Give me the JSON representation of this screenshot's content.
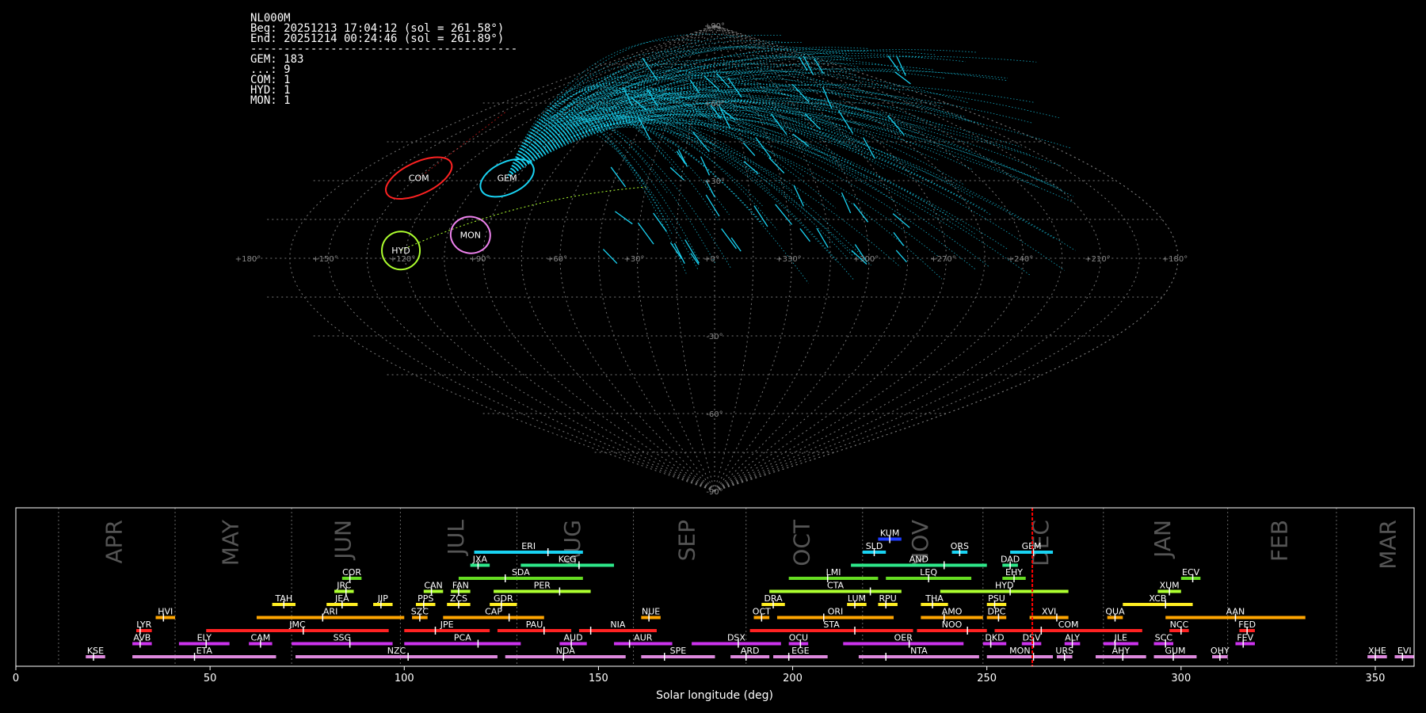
{
  "info": {
    "station": "NL000M",
    "beg": "Beg: 20251213 17:04:12 (sol = 261.58°)",
    "end": "End: 20251214 00:24:46 (sol = 261.89°)",
    "separator": "----------------------------------------",
    "counts": [
      "GEM: 183",
      "...: 9",
      "COM: 1",
      "HYD: 1",
      "MON: 1"
    ]
  },
  "chart_data": [
    {
      "type": "scatter",
      "projection": "sinusoidal sky map",
      "lon_tick_labels": [
        "+180°",
        "+150°",
        "+120°",
        "+90°",
        "+60°",
        "+30°",
        "+0°",
        "+330°",
        "+300°",
        "+270°",
        "+240°",
        "+210°",
        "+180°"
      ],
      "lat_tick_labels": [
        "+90°",
        "+60°",
        "+30°",
        "-30°",
        "-60°",
        "-90°"
      ],
      "radiants": [
        {
          "name": "COM",
          "lon": 134,
          "lat": 31,
          "color": "#ff2222"
        },
        {
          "name": "GEM",
          "lon": 94,
          "lat": 31,
          "color": "#19d3f3"
        },
        {
          "name": "MON",
          "lon": 96,
          "lat": 9,
          "color": "#ee82ee"
        },
        {
          "name": "HYD",
          "lon": 122,
          "lat": 3,
          "color": "#adff2f"
        }
      ],
      "meteor_counts": {
        "GEM": 183,
        "...": 9,
        "COM": 1,
        "HYD": 1,
        "MON": 1
      }
    },
    {
      "type": "timeline",
      "xlabel": "Solar longitude (deg)",
      "xlim": [
        0,
        360
      ],
      "xticks": [
        0,
        50,
        100,
        150,
        200,
        250,
        300,
        350
      ],
      "current_sol": 261.7,
      "months": [
        {
          "label": "APR",
          "start": 11
        },
        {
          "label": "MAY",
          "start": 41
        },
        {
          "label": "JUN",
          "start": 71
        },
        {
          "label": "JUL",
          "start": 99
        },
        {
          "label": "AUG",
          "start": 129
        },
        {
          "label": "SEP",
          "start": 159
        },
        {
          "label": "OCT",
          "start": 188
        },
        {
          "label": "NOV",
          "start": 218
        },
        {
          "label": "DEC",
          "start": 249
        },
        {
          "label": "JAN",
          "start": 280
        },
        {
          "label": "FEB",
          "start": 312
        },
        {
          "label": "MAR",
          "start": 340
        }
      ],
      "showers": [
        {
          "code": "KUM",
          "start": 222,
          "end": 228,
          "peak": 225,
          "row": 9,
          "color": "#1e3cff"
        },
        {
          "code": "ERI",
          "start": 118,
          "end": 146,
          "peak": 137,
          "row": 8,
          "color": "#19d3f3"
        },
        {
          "code": "SLD",
          "start": 218,
          "end": 224,
          "peak": 221,
          "row": 8,
          "color": "#19d3f3"
        },
        {
          "code": "ORS",
          "start": 241,
          "end": 245,
          "peak": 243,
          "row": 8,
          "color": "#19d3f3"
        },
        {
          "code": "GEM",
          "start": 256,
          "end": 267,
          "peak": 262,
          "row": 8,
          "color": "#19d3f3"
        },
        {
          "code": "JXA",
          "start": 117,
          "end": 122,
          "peak": 119,
          "row": 7,
          "color": "#2ee88a"
        },
        {
          "code": "KCG",
          "start": 130,
          "end": 154,
          "peak": 145,
          "row": 7,
          "color": "#2ee88a"
        },
        {
          "code": "AND",
          "start": 215,
          "end": 250,
          "peak": 239,
          "row": 7,
          "color": "#2ee88a"
        },
        {
          "code": "DAD",
          "start": 254,
          "end": 258,
          "peak": 256,
          "row": 7,
          "color": "#2ee88a"
        },
        {
          "code": "COR",
          "start": 84,
          "end": 89,
          "peak": 86,
          "row": 6,
          "color": "#66dd22"
        },
        {
          "code": "SDA",
          "start": 114,
          "end": 146,
          "peak": 126,
          "row": 6,
          "color": "#66dd22"
        },
        {
          "code": "LMI",
          "start": 199,
          "end": 222,
          "peak": 209,
          "row": 6,
          "color": "#66dd22"
        },
        {
          "code": "LEQ",
          "start": 224,
          "end": 246,
          "peak": 235,
          "row": 6,
          "color": "#66dd22"
        },
        {
          "code": "EHY",
          "start": 254,
          "end": 260,
          "peak": 257,
          "row": 6,
          "color": "#66dd22"
        },
        {
          "code": "ECV",
          "start": 300,
          "end": 305,
          "peak": 303,
          "row": 6,
          "color": "#66dd22"
        },
        {
          "code": "JRC",
          "start": 82,
          "end": 87,
          "peak": 85,
          "row": 5,
          "color": "#adff2f"
        },
        {
          "code": "CAN",
          "start": 105,
          "end": 110,
          "peak": 107,
          "row": 5,
          "color": "#adff2f"
        },
        {
          "code": "FAN",
          "start": 112,
          "end": 117,
          "peak": 114,
          "row": 5,
          "color": "#adff2f"
        },
        {
          "code": "PER",
          "start": 123,
          "end": 148,
          "peak": 140,
          "row": 5,
          "color": "#adff2f"
        },
        {
          "code": "CTA",
          "start": 194,
          "end": 228,
          "peak": 220,
          "row": 5,
          "color": "#adff2f"
        },
        {
          "code": "HYD",
          "start": 238,
          "end": 271,
          "peak": 256,
          "row": 5,
          "color": "#adff2f"
        },
        {
          "code": "XUM",
          "start": 294,
          "end": 300,
          "peak": 297,
          "row": 5,
          "color": "#adff2f"
        },
        {
          "code": "TAH",
          "start": 66,
          "end": 72,
          "peak": 69,
          "row": 4,
          "color": "#ffee22"
        },
        {
          "code": "JEA",
          "start": 80,
          "end": 88,
          "peak": 84,
          "row": 4,
          "color": "#ffee22"
        },
        {
          "code": "JIP",
          "start": 92,
          "end": 97,
          "peak": 94,
          "row": 4,
          "color": "#ffee22"
        },
        {
          "code": "PPS",
          "start": 103,
          "end": 108,
          "peak": 105,
          "row": 4,
          "color": "#ffee22"
        },
        {
          "code": "ZCS",
          "start": 111,
          "end": 117,
          "peak": 114,
          "row": 4,
          "color": "#ffee22"
        },
        {
          "code": "GDR",
          "start": 122,
          "end": 129,
          "peak": 125,
          "row": 4,
          "color": "#ffee22"
        },
        {
          "code": "DRA",
          "start": 192,
          "end": 198,
          "peak": 195,
          "row": 4,
          "color": "#ffee22"
        },
        {
          "code": "LUM",
          "start": 214,
          "end": 219,
          "peak": 216,
          "row": 4,
          "color": "#ffee22"
        },
        {
          "code": "RPU",
          "start": 222,
          "end": 227,
          "peak": 224,
          "row": 4,
          "color": "#ffee22"
        },
        {
          "code": "THA",
          "start": 233,
          "end": 240,
          "peak": 236,
          "row": 4,
          "color": "#ffee22"
        },
        {
          "code": "PSU",
          "start": 250,
          "end": 255,
          "peak": 252,
          "row": 4,
          "color": "#ffee22"
        },
        {
          "code": "XCB",
          "start": 285,
          "end": 303,
          "peak": 296,
          "row": 4,
          "color": "#ffee22"
        },
        {
          "code": "HVI",
          "start": 36,
          "end": 41,
          "peak": 38,
          "row": 3,
          "color": "#ffa500"
        },
        {
          "code": "ARI",
          "start": 62,
          "end": 100,
          "peak": 79,
          "row": 3,
          "color": "#ffa500"
        },
        {
          "code": "SZC",
          "start": 102,
          "end": 106,
          "peak": 104,
          "row": 3,
          "color": "#ffa500"
        },
        {
          "code": "CAP",
          "start": 110,
          "end": 136,
          "peak": 127,
          "row": 3,
          "color": "#ffa500"
        },
        {
          "code": "NUE",
          "start": 161,
          "end": 166,
          "peak": 163,
          "row": 3,
          "color": "#ffa500"
        },
        {
          "code": "OCT",
          "start": 190,
          "end": 194,
          "peak": 192,
          "row": 3,
          "color": "#ffa500"
        },
        {
          "code": "ORI",
          "start": 196,
          "end": 226,
          "peak": 208,
          "row": 3,
          "color": "#ffa500"
        },
        {
          "code": "AMO",
          "start": 233,
          "end": 249,
          "peak": 239,
          "row": 3,
          "color": "#ffa500"
        },
        {
          "code": "DPC",
          "start": 250,
          "end": 255,
          "peak": 253,
          "row": 3,
          "color": "#ffa500"
        },
        {
          "code": "XVI",
          "start": 261,
          "end": 271,
          "peak": 268,
          "row": 3,
          "color": "#ffa500"
        },
        {
          "code": "QUA",
          "start": 281,
          "end": 285,
          "peak": 283,
          "row": 3,
          "color": "#ffa500"
        },
        {
          "code": "AAN",
          "start": 296,
          "end": 332,
          "peak": 314,
          "row": 3,
          "color": "#ffa500"
        },
        {
          "code": "LYR",
          "start": 31,
          "end": 35,
          "peak": 32,
          "row": 2,
          "color": "#ff2222"
        },
        {
          "code": "JMC",
          "start": 49,
          "end": 96,
          "peak": 74,
          "row": 2,
          "color": "#ff2222"
        },
        {
          "code": "JPE",
          "start": 100,
          "end": 122,
          "peak": 108,
          "row": 2,
          "color": "#ff2222"
        },
        {
          "code": "PAU",
          "start": 124,
          "end": 143,
          "peak": 136,
          "row": 2,
          "color": "#ff2222"
        },
        {
          "code": "NIA",
          "start": 145,
          "end": 165,
          "peak": 148,
          "row": 2,
          "color": "#ff2222"
        },
        {
          "code": "STA",
          "start": 189,
          "end": 231,
          "peak": 216,
          "row": 2,
          "color": "#ff2222"
        },
        {
          "code": "NOO",
          "start": 232,
          "end": 250,
          "peak": 245,
          "row": 2,
          "color": "#ff2222"
        },
        {
          "code": "COM",
          "start": 252,
          "end": 290,
          "peak": 264,
          "row": 2,
          "color": "#ff2222"
        },
        {
          "code": "NCC",
          "start": 297,
          "end": 302,
          "peak": 300,
          "row": 2,
          "color": "#ff2222"
        },
        {
          "code": "FED",
          "start": 315,
          "end": 319,
          "peak": 317,
          "row": 2,
          "color": "#ff2222"
        },
        {
          "code": "AVB",
          "start": 30,
          "end": 35,
          "peak": 32,
          "row": 1,
          "color": "#cc33ee"
        },
        {
          "code": "ELY",
          "start": 42,
          "end": 55,
          "peak": 49,
          "row": 1,
          "color": "#cc33ee"
        },
        {
          "code": "CAM",
          "start": 60,
          "end": 66,
          "peak": 63,
          "row": 1,
          "color": "#cc33ee"
        },
        {
          "code": "SSG",
          "start": 71,
          "end": 97,
          "peak": 86,
          "row": 1,
          "color": "#cc33ee"
        },
        {
          "code": "PCA",
          "start": 100,
          "end": 130,
          "peak": 119,
          "row": 1,
          "color": "#cc33ee"
        },
        {
          "code": "AUD",
          "start": 140,
          "end": 147,
          "peak": 143,
          "row": 1,
          "color": "#cc33ee"
        },
        {
          "code": "AUR",
          "start": 154,
          "end": 169,
          "peak": 158,
          "row": 1,
          "color": "#cc33ee"
        },
        {
          "code": "DSX",
          "start": 174,
          "end": 197,
          "peak": 186,
          "row": 1,
          "color": "#cc33ee"
        },
        {
          "code": "OCU",
          "start": 199,
          "end": 204,
          "peak": 202,
          "row": 1,
          "color": "#cc33ee"
        },
        {
          "code": "OER",
          "start": 213,
          "end": 244,
          "peak": 230,
          "row": 1,
          "color": "#cc33ee"
        },
        {
          "code": "DKD",
          "start": 249,
          "end": 255,
          "peak": 251,
          "row": 1,
          "color": "#cc33ee"
        },
        {
          "code": "DSV",
          "start": 259,
          "end": 264,
          "peak": 262,
          "row": 1,
          "color": "#cc33ee"
        },
        {
          "code": "ALY",
          "start": 270,
          "end": 274,
          "peak": 272,
          "row": 1,
          "color": "#cc33ee"
        },
        {
          "code": "JLE",
          "start": 280,
          "end": 289,
          "peak": 283,
          "row": 1,
          "color": "#cc33ee"
        },
        {
          "code": "SCC",
          "start": 293,
          "end": 298,
          "peak": 296,
          "row": 1,
          "color": "#cc33ee"
        },
        {
          "code": "FEV",
          "start": 314,
          "end": 319,
          "peak": 316,
          "row": 1,
          "color": "#cc33ee"
        },
        {
          "code": "KSE",
          "start": 18,
          "end": 23,
          "peak": 20,
          "row": 0,
          "color": "#dd88dd"
        },
        {
          "code": "ETA",
          "start": 30,
          "end": 67,
          "peak": 46,
          "row": 0,
          "color": "#dd88dd"
        },
        {
          "code": "NZC",
          "start": 72,
          "end": 124,
          "peak": 101,
          "row": 0,
          "color": "#dd88dd"
        },
        {
          "code": "NDA",
          "start": 126,
          "end": 157,
          "peak": 141,
          "row": 0,
          "color": "#dd88dd"
        },
        {
          "code": "SPE",
          "start": 161,
          "end": 180,
          "peak": 167,
          "row": 0,
          "color": "#dd88dd"
        },
        {
          "code": "ARD",
          "start": 184,
          "end": 194,
          "peak": 188,
          "row": 0,
          "color": "#dd88dd"
        },
        {
          "code": "EGE",
          "start": 195,
          "end": 209,
          "peak": 199,
          "row": 0,
          "color": "#dd88dd"
        },
        {
          "code": "NTA",
          "start": 217,
          "end": 248,
          "peak": 224,
          "row": 0,
          "color": "#dd88dd"
        },
        {
          "code": "MON",
          "start": 250,
          "end": 267,
          "peak": 262,
          "row": 0,
          "color": "#dd88dd"
        },
        {
          "code": "URS",
          "start": 268,
          "end": 272,
          "peak": 270,
          "row": 0,
          "color": "#dd88dd"
        },
        {
          "code": "AHY",
          "start": 278,
          "end": 291,
          "peak": 285,
          "row": 0,
          "color": "#dd88dd"
        },
        {
          "code": "GUM",
          "start": 293,
          "end": 304,
          "peak": 298,
          "row": 0,
          "color": "#dd88dd"
        },
        {
          "code": "OHY",
          "start": 308,
          "end": 312,
          "peak": 310,
          "row": 0,
          "color": "#dd88dd"
        },
        {
          "code": "XHE",
          "start": 348,
          "end": 353,
          "peak": 350,
          "row": 0,
          "color": "#dd88dd"
        },
        {
          "code": "EVI",
          "start": 355,
          "end": 360,
          "peak": 357,
          "row": 0,
          "color": "#dd88dd"
        }
      ]
    }
  ]
}
